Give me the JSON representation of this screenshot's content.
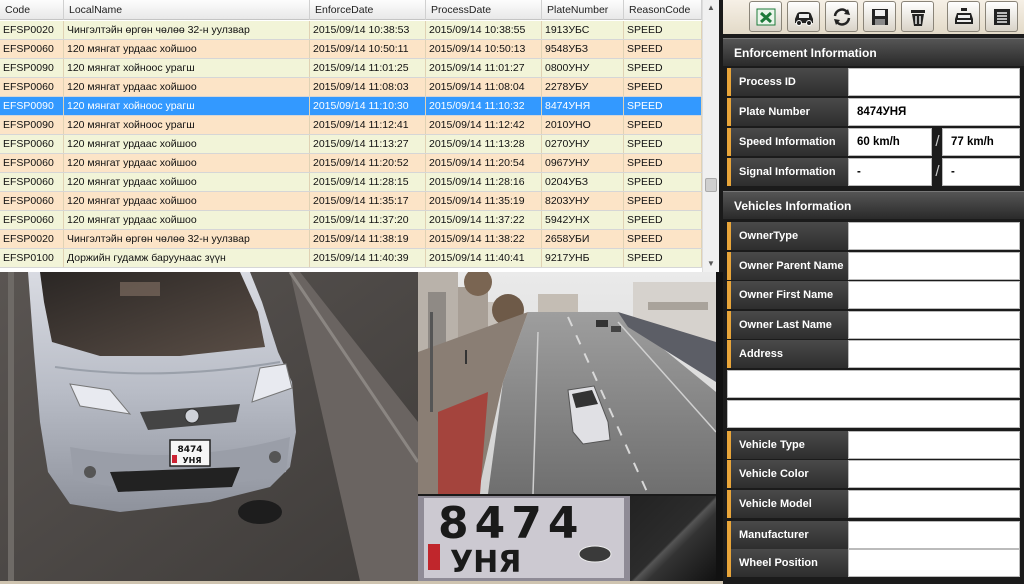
{
  "grid": {
    "columns": [
      "Code",
      "LocalName",
      "EnforceDate",
      "ProcessDate",
      "PlateNumber",
      "ReasonCode"
    ],
    "rows": [
      [
        "EFSP0020",
        "Чингэлтэйн өргөн чөлөө 32-н уулзвар",
        "2015/09/14 10:38:53",
        "2015/09/14 10:38:55",
        "1913УБС",
        "SPEED"
      ],
      [
        "EFSP0060",
        "120 мянгат урдаас хойшоо",
        "2015/09/14 10:50:11",
        "2015/09/14 10:50:13",
        "9548УБЗ",
        "SPEED"
      ],
      [
        "EFSP0090",
        "120 мянгат хойноос урагш",
        "2015/09/14 11:01:25",
        "2015/09/14 11:01:27",
        "0800УНУ",
        "SPEED"
      ],
      [
        "EFSP0060",
        "120 мянгат урдаас хойшоо",
        "2015/09/14 11:08:03",
        "2015/09/14 11:08:04",
        "2278УБУ",
        "SPEED"
      ],
      [
        "EFSP0090",
        "120 мянгат хойноос урагш",
        "2015/09/14 11:10:30",
        "2015/09/14 11:10:32",
        "8474УНЯ",
        "SPEED"
      ],
      [
        "EFSP0090",
        "120 мянгат хойноос урагш",
        "2015/09/14 11:12:41",
        "2015/09/14 11:12:42",
        "2010УНО",
        "SPEED"
      ],
      [
        "EFSP0060",
        "120 мянгат урдаас хойшоо",
        "2015/09/14 11:13:27",
        "2015/09/14 11:13:28",
        "0270УНУ",
        "SPEED"
      ],
      [
        "EFSP0060",
        "120 мянгат урдаас хойшоо",
        "2015/09/14 11:20:52",
        "2015/09/14 11:20:54",
        "0967УНУ",
        "SPEED"
      ],
      [
        "EFSP0060",
        "120 мянгат урдаас хойшоо",
        "2015/09/14 11:28:15",
        "2015/09/14 11:28:16",
        "0204УБЗ",
        "SPEED"
      ],
      [
        "EFSP0060",
        "120 мянгат урдаас хойшоо",
        "2015/09/14 11:35:17",
        "2015/09/14 11:35:19",
        "8203УНУ",
        "SPEED"
      ],
      [
        "EFSP0060",
        "120 мянгат урдаас хойшоо",
        "2015/09/14 11:37:20",
        "2015/09/14 11:37:22",
        "5942УНХ",
        "SPEED"
      ],
      [
        "EFSP0020",
        "Чингэлтэйн өргөн чөлөө 32-н уулзвар",
        "2015/09/14 11:38:19",
        "2015/09/14 11:38:22",
        "2658УБИ",
        "SPEED"
      ],
      [
        "EFSP0100",
        "Доржийн гудамж баруунаас зүүн",
        "2015/09/14 11:40:39",
        "2015/09/14 11:40:41",
        "9217УНБ",
        "SPEED"
      ]
    ],
    "selected_row": 4
  },
  "toolbar": {
    "buttons": [
      {
        "name": "excel-export-button",
        "icon": "excel-icon"
      },
      {
        "name": "vehicle-button",
        "icon": "car-icon"
      },
      {
        "name": "refresh-button",
        "icon": "refresh-icon"
      },
      {
        "name": "save-button",
        "icon": "floppy-icon"
      },
      {
        "name": "delete-button",
        "icon": "trash-icon"
      },
      {
        "name": "police-button",
        "icon": "police-car-icon"
      },
      {
        "name": "list-button",
        "icon": "list-icon"
      }
    ]
  },
  "enforcement": {
    "title": "Enforcement Information",
    "process_id_label": "Process ID",
    "process_id": "",
    "plate_number_label": "Plate Number",
    "plate_number": "8474УНЯ",
    "speed_label": "Speed Information",
    "speed_measured": "60 km/h",
    "speed_limit": "77 km/h",
    "signal_label": "Signal Information",
    "signal_a": "-",
    "signal_b": "-",
    "separator": "/"
  },
  "vehicles": {
    "title": "Vehicles Information",
    "fields": [
      {
        "label": "OwnerType",
        "value": ""
      },
      {
        "label": "Owner Parent Name",
        "value": ""
      },
      {
        "label": "Owner First Name",
        "value": ""
      },
      {
        "label": "Owner Last Name",
        "value": ""
      },
      {
        "label": "Address",
        "value": ""
      }
    ],
    "vehicle_fields": [
      {
        "label": "Vehicle Type",
        "value": ""
      },
      {
        "label": "Vehicle Color",
        "value": ""
      },
      {
        "label": "Vehicle Model",
        "value": ""
      },
      {
        "label": "Manufacturer",
        "value": ""
      },
      {
        "label": "Wheel Position",
        "value": ""
      }
    ]
  },
  "images": {
    "main_plate_text": "8474",
    "main_plate_suffix": "УНЯ",
    "crop_plate_digits": "8474",
    "crop_plate_letters": "УНЯ"
  },
  "colors": {
    "selected_row": "#3399ff",
    "row_even": "#fce4c7",
    "row_odd": "#f2f4d8",
    "label_accent": "#e8a53a"
  }
}
